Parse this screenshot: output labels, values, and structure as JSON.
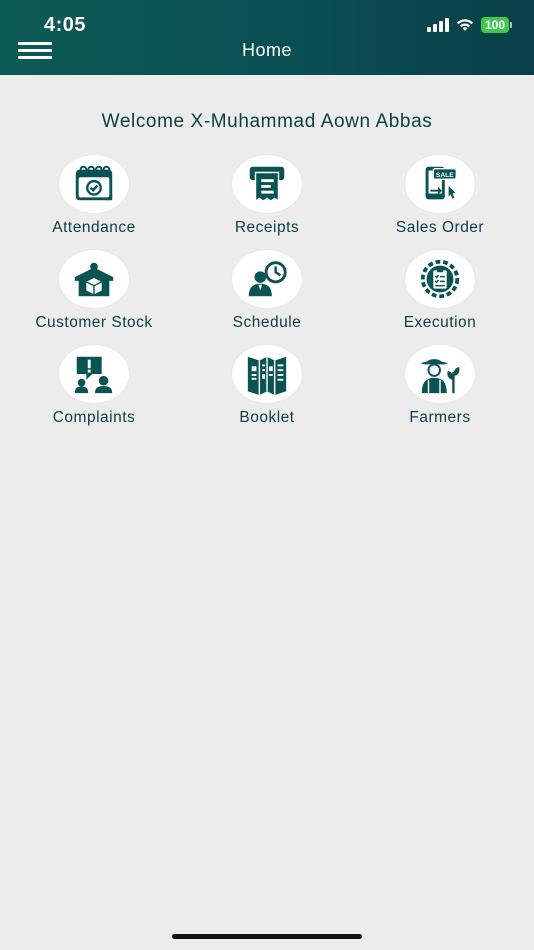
{
  "status_bar": {
    "time": "4:05",
    "battery": "100"
  },
  "header": {
    "title": "Home"
  },
  "welcome": "Welcome X-Muhammad Aown Abbas",
  "tiles": [
    {
      "label": "Attendance",
      "icon": "calendar-check-icon"
    },
    {
      "label": "Receipts",
      "icon": "receipt-icon"
    },
    {
      "label": "Sales Order",
      "icon": "sale-tag-icon"
    },
    {
      "label": "Customer Stock",
      "icon": "warehouse-box-icon"
    },
    {
      "label": "Schedule",
      "icon": "person-clock-icon"
    },
    {
      "label": "Execution",
      "icon": "clipboard-gear-icon"
    },
    {
      "label": "Complaints",
      "icon": "complaint-speech-icon"
    },
    {
      "label": "Booklet",
      "icon": "open-booklet-icon"
    },
    {
      "label": "Farmers",
      "icon": "farmer-plant-icon"
    }
  ],
  "colors": {
    "primary": "#0a5355",
    "background": "#ececec",
    "text": "#0c3f44"
  }
}
